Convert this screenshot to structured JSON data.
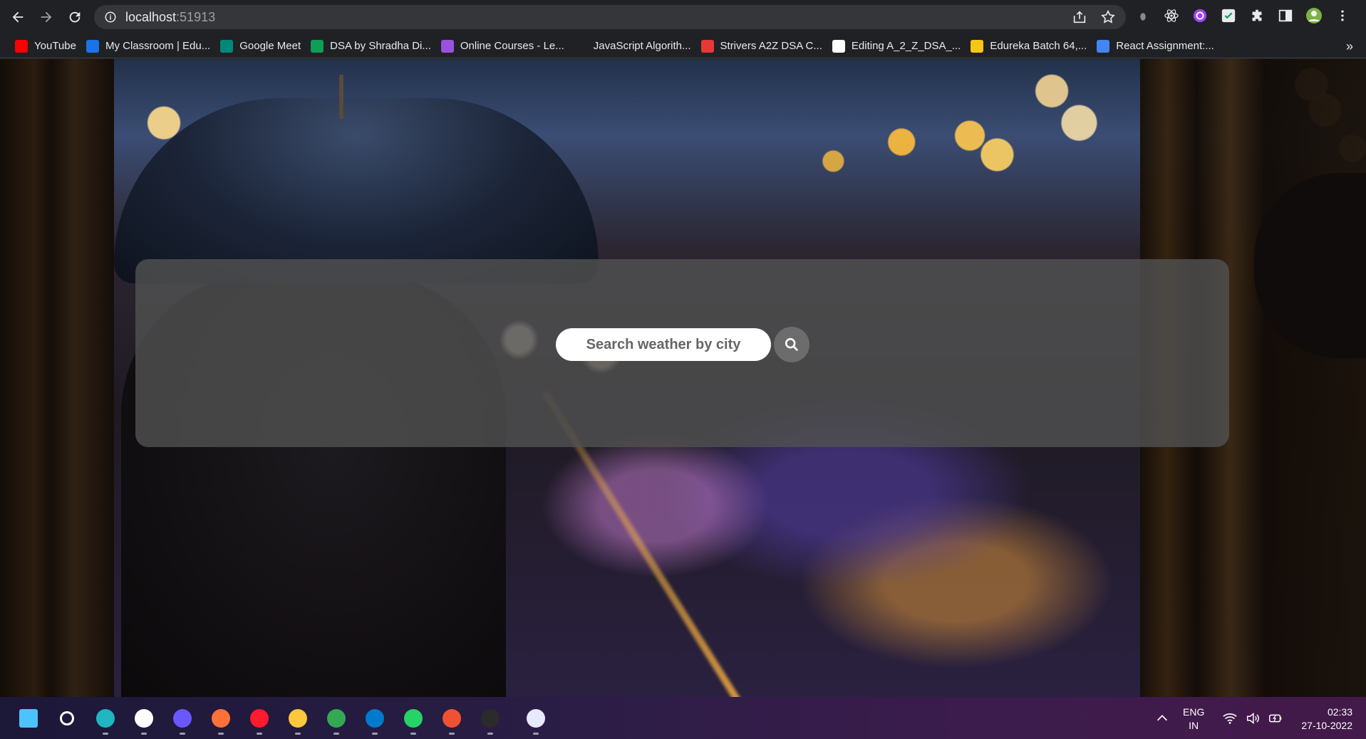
{
  "browser": {
    "url_host": "localhost",
    "url_port": ":51913"
  },
  "bookmarks": [
    {
      "label": "YouTube",
      "color": "#ff0000",
      "icon": "youtube-icon"
    },
    {
      "label": "My Classroom | Edu...",
      "color": "#1a73e8",
      "icon": "edureka-icon"
    },
    {
      "label": "Google Meet",
      "color": "#00897b",
      "icon": "google-meet-icon"
    },
    {
      "label": "DSA by Shradha Di...",
      "color": "#0f9d58",
      "icon": "sheets-icon"
    },
    {
      "label": "Online Courses - Le...",
      "color": "#9b51e0",
      "icon": "courses-icon"
    },
    {
      "label": "JavaScript Algorith...",
      "color": "#202124",
      "icon": "freecodecamp-icon"
    },
    {
      "label": "Strivers A2Z DSA C...",
      "color": "#e53935",
      "icon": "tuf-icon"
    },
    {
      "label": "Editing A_2_Z_DSA_...",
      "color": "#ffffff",
      "icon": "github-icon"
    },
    {
      "label": "Edureka Batch 64,...",
      "color": "#f5c518",
      "icon": "miro-icon"
    },
    {
      "label": "React Assignment:...",
      "color": "#4285f4",
      "icon": "docs-icon"
    }
  ],
  "search": {
    "placeholder": "Search weather by city",
    "value": ""
  },
  "taskbar": {
    "apps": [
      {
        "name": "windows-start-icon",
        "color": "#4cc2ff"
      },
      {
        "name": "search-icon",
        "color": "#ffffff"
      },
      {
        "name": "edge-icon",
        "color": "#1fb6c1"
      },
      {
        "name": "mongodb-compass-icon",
        "color": "#ffffff"
      },
      {
        "name": "intellij-icon",
        "color": "#6b57ff"
      },
      {
        "name": "firefox-icon",
        "color": "#ff7139"
      },
      {
        "name": "opera-icon",
        "color": "#ff1b2d"
      },
      {
        "name": "file-explorer-icon",
        "color": "#ffc83d"
      },
      {
        "name": "chrome-icon",
        "color": "#34a853"
      },
      {
        "name": "vscode-icon",
        "color": "#007acc"
      },
      {
        "name": "whatsapp-icon",
        "color": "#25d366"
      },
      {
        "name": "git-icon",
        "color": "#f05133"
      },
      {
        "name": "terminal-icon",
        "color": "#2b2b2b"
      },
      {
        "name": "snipping-tool-icon",
        "color": "#e8e8ff"
      }
    ],
    "lang_top": "ENG",
    "lang_bottom": "IN",
    "time": "02:33",
    "date": "27-10-2022"
  }
}
